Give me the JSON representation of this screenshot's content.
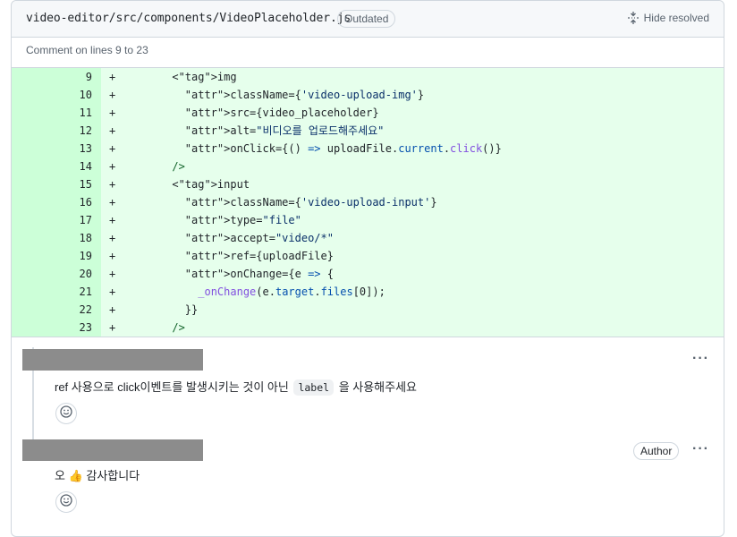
{
  "file_header": {
    "path": "video-editor/src/components/VideoPlaceholder.js",
    "outdated_label": "Outdated",
    "hide_resolved_label": "Hide resolved"
  },
  "lines_caption": "Comment on lines 9 to 23",
  "diff": {
    "added_color": "#e6ffec",
    "gutter_color": "#ccffd8",
    "rows": [
      {
        "ln": "9",
        "sign": "+",
        "code": "      <img"
      },
      {
        "ln": "10",
        "sign": "+",
        "code": "        className={'video-upload-img'}"
      },
      {
        "ln": "11",
        "sign": "+",
        "code": "        src={video_placeholder}"
      },
      {
        "ln": "12",
        "sign": "+",
        "code": "        alt=\"비디오를 업로드해주세요\""
      },
      {
        "ln": "13",
        "sign": "+",
        "code": "        onClick={() => uploadFile.current.click()}"
      },
      {
        "ln": "14",
        "sign": "+",
        "code": "      />"
      },
      {
        "ln": "15",
        "sign": "+",
        "code": "      <input"
      },
      {
        "ln": "16",
        "sign": "+",
        "code": "        className={'video-upload-input'}"
      },
      {
        "ln": "17",
        "sign": "+",
        "code": "        type=\"file\""
      },
      {
        "ln": "18",
        "sign": "+",
        "code": "        accept=\"video/*\""
      },
      {
        "ln": "19",
        "sign": "+",
        "code": "        ref={uploadFile}"
      },
      {
        "ln": "20",
        "sign": "+",
        "code": "        onChange={e => {"
      },
      {
        "ln": "21",
        "sign": "+",
        "code": "          _onChange(e.target.files[0]);"
      },
      {
        "ln": "22",
        "sign": "+",
        "code": "        }}"
      },
      {
        "ln": "23",
        "sign": "+",
        "code": "      />"
      }
    ]
  },
  "comments": [
    {
      "text_before": "ref 사용으로 click이벤트를 발생시키는 것이 아닌 ",
      "code": "label",
      "text_after": " 을 사용해주세요"
    },
    {
      "author_badge": "Author",
      "text": "오 👍 감사합니다"
    }
  ],
  "icons": {
    "hide_resolved": "fold-icon",
    "more": "kebab-horizontal-icon",
    "reaction": "smiley-icon"
  }
}
